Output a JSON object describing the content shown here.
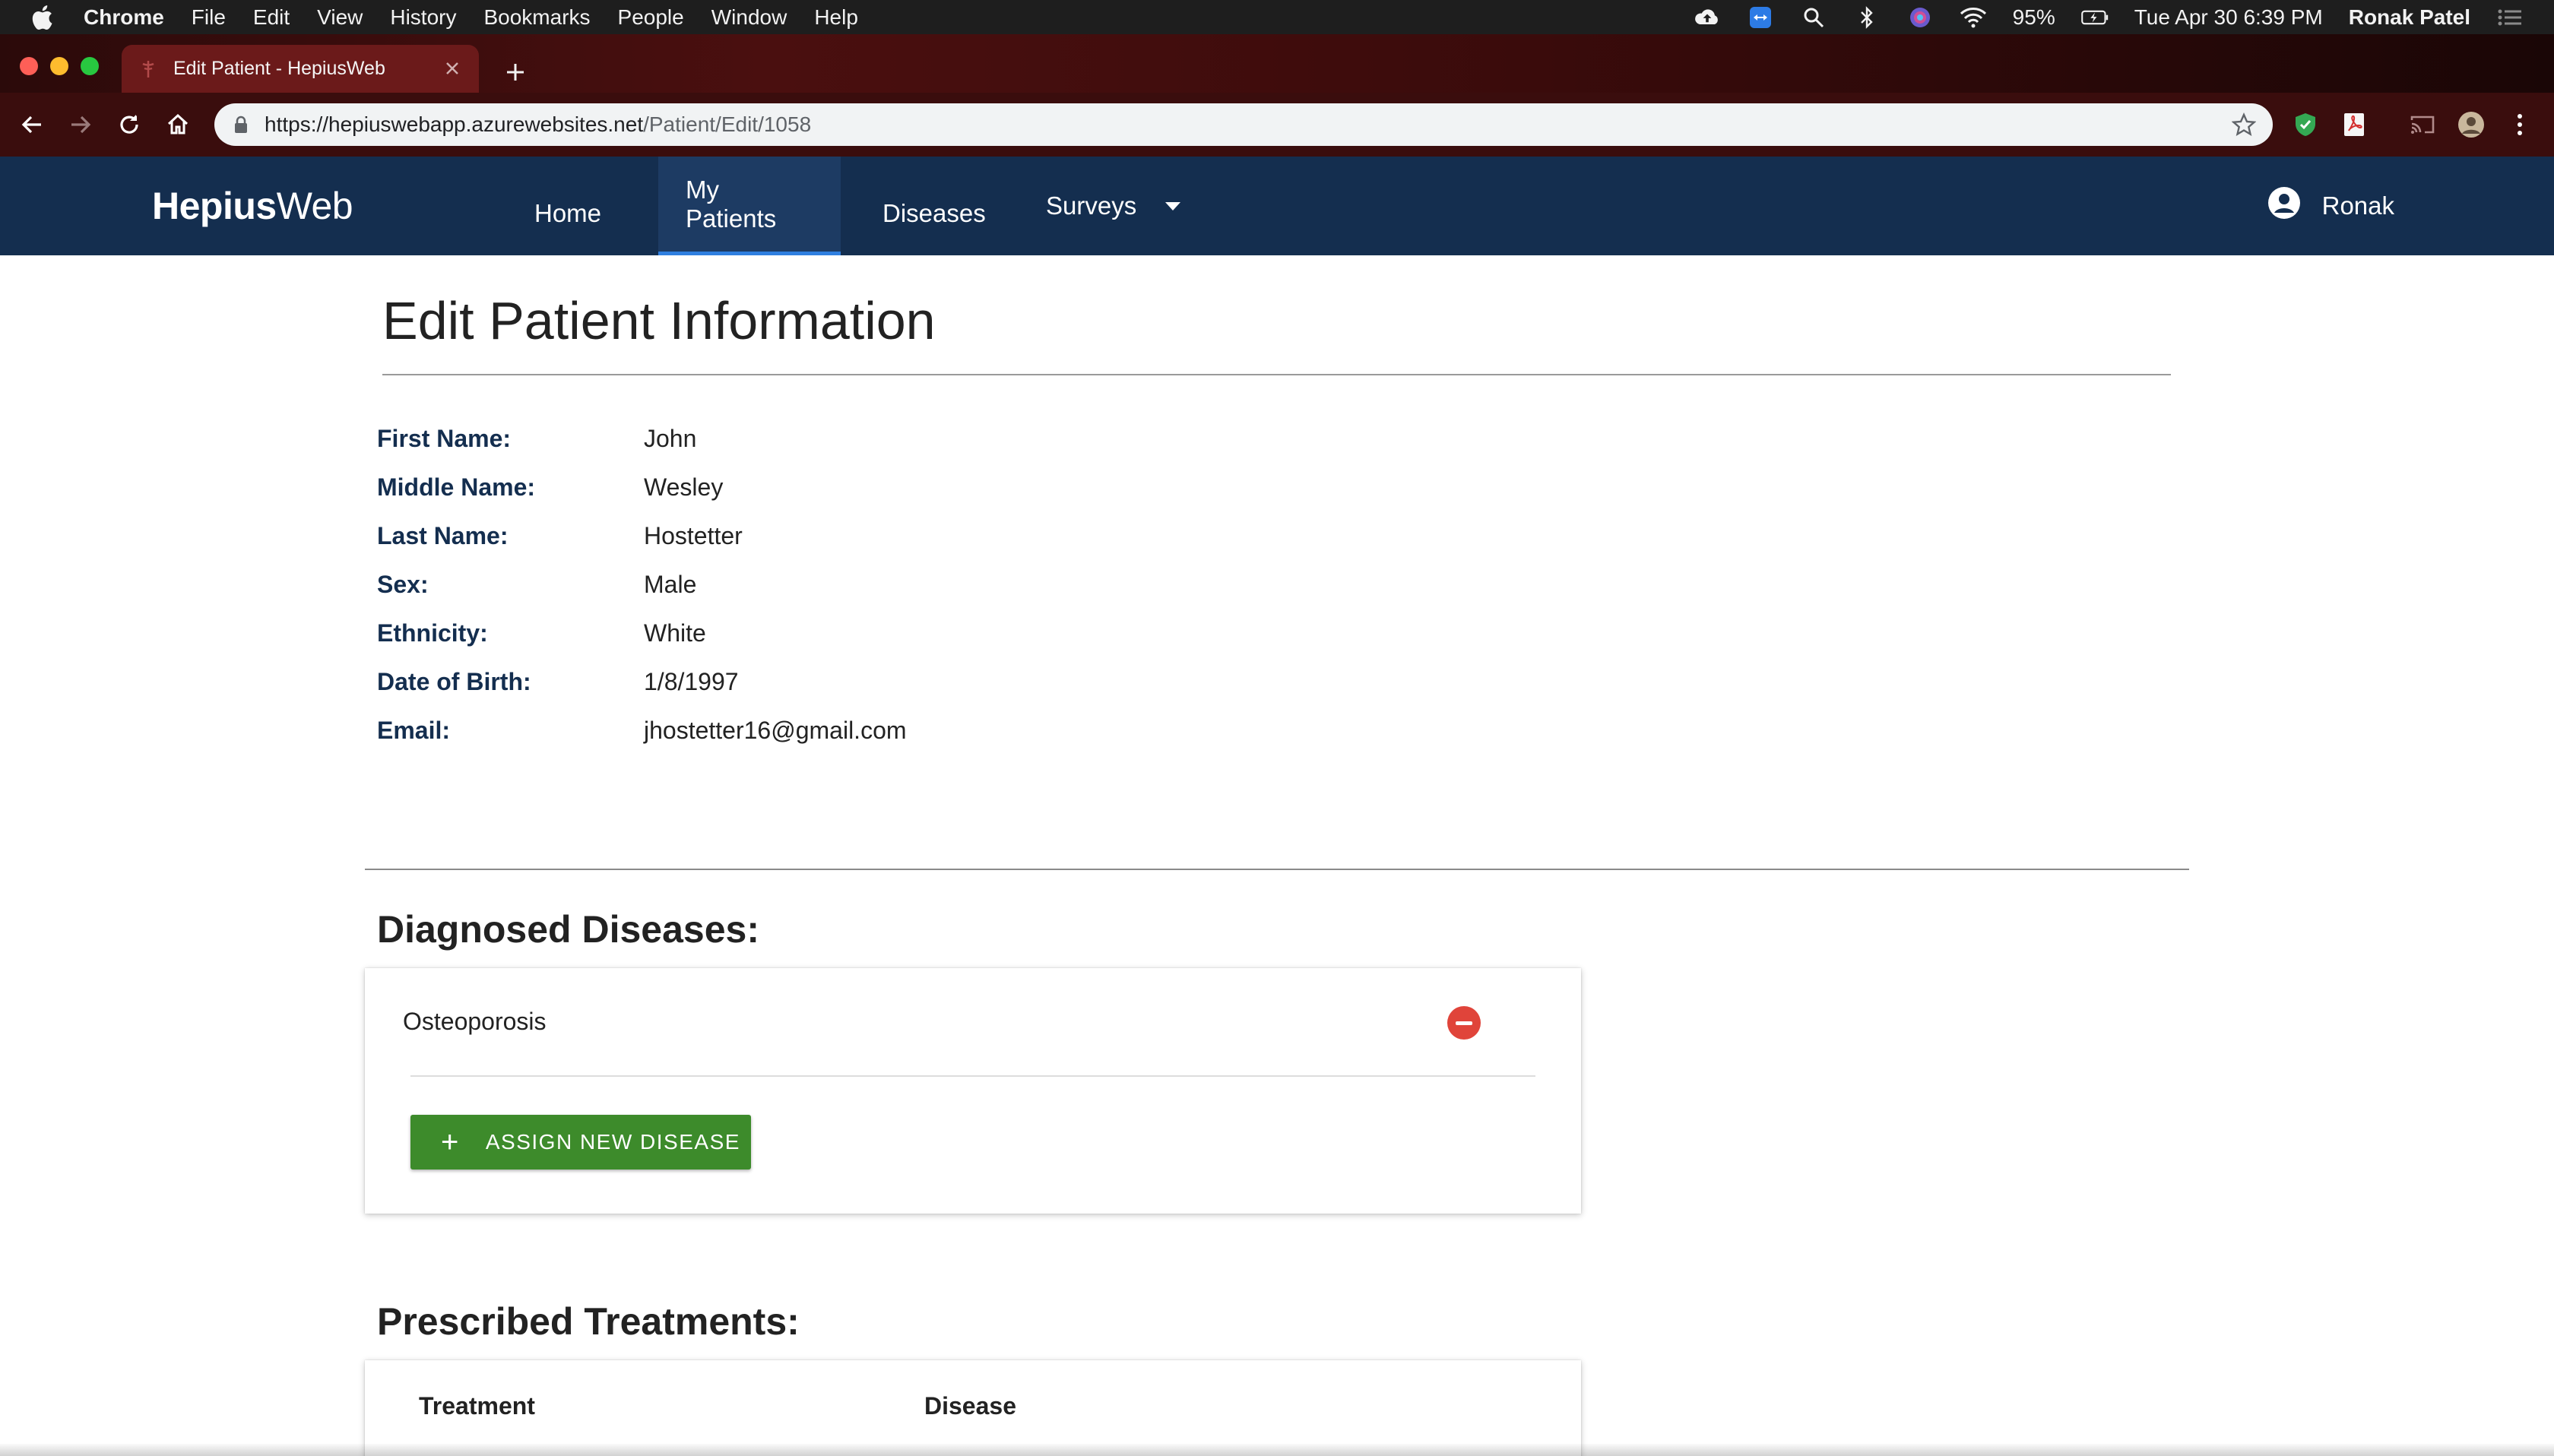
{
  "menubar": {
    "app_name": "Chrome",
    "items": [
      "File",
      "Edit",
      "View",
      "History",
      "Bookmarks",
      "People",
      "Window",
      "Help"
    ],
    "battery": "95%",
    "datetime": "Tue Apr 30  6:39 PM",
    "user": "Ronak Patel"
  },
  "browser": {
    "tab_title": "Edit Patient - HepiusWeb",
    "url_host": "https://hepiuswebapp.azurewebsites.net",
    "url_path": "/Patient/Edit/1058"
  },
  "navbar": {
    "brand_bold": "Hepius",
    "brand_rest": "Web",
    "items": [
      "Home",
      "My Patients",
      "Diseases",
      "Surveys"
    ],
    "active_item": "My Patients",
    "user_name": "Ronak",
    "colors": {
      "background": "#142e4f",
      "active_indicator": "#2f7fe0"
    }
  },
  "page": {
    "title": "Edit Patient Information",
    "fields": [
      {
        "label": "First Name:",
        "value": "John"
      },
      {
        "label": "Middle Name:",
        "value": "Wesley"
      },
      {
        "label": "Last Name:",
        "value": "Hostetter"
      },
      {
        "label": "Sex:",
        "value": "Male"
      },
      {
        "label": "Ethnicity:",
        "value": "White"
      },
      {
        "label": "Date of Birth:",
        "value": "1/8/1997"
      },
      {
        "label": "Email:",
        "value": "jhostetter16@gmail.com"
      }
    ]
  },
  "diseases": {
    "heading": "Diagnosed Diseases:",
    "items": [
      "Osteoporosis"
    ],
    "assign_button": "ASSIGN NEW DISEASE",
    "colors": {
      "remove": "#e0443a",
      "assign": "#3d8b2b"
    }
  },
  "treatments": {
    "heading": "Prescribed Treatments:",
    "columns": [
      "Treatment",
      "Disease"
    ]
  }
}
